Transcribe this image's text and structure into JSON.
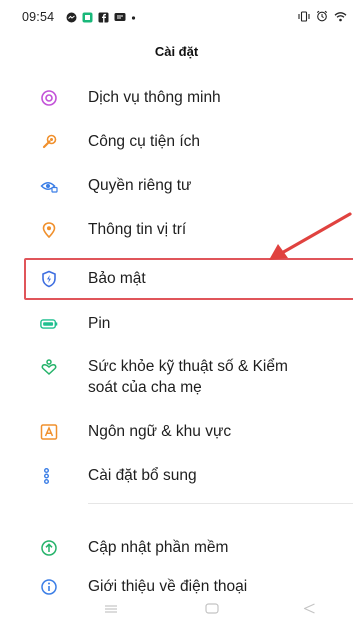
{
  "status_bar": {
    "time": "09:54"
  },
  "header": {
    "title": "Cài đặt"
  },
  "items": [
    {
      "label": "Dịch vụ thông minh",
      "icon": "smart-services-icon",
      "color": "#c251d8"
    },
    {
      "label": "Công cụ tiện ích",
      "icon": "utility-tools-icon",
      "color": "#f0902d"
    },
    {
      "label": "Quyền riêng tư",
      "icon": "privacy-icon",
      "color": "#3b7ee6"
    },
    {
      "label": "Thông tin vị trí",
      "icon": "location-icon",
      "color": "#f0902d"
    },
    {
      "label": "Bảo mật",
      "icon": "security-shield-icon",
      "color": "#3f6fe0"
    },
    {
      "label": "Pin",
      "icon": "battery-icon",
      "color": "#1fbf8f"
    },
    {
      "label": "Sức khỏe kỹ thuật số & Kiểm",
      "label_line2": "soát của cha mẹ",
      "icon": "digital-wellbeing-icon",
      "color": "#25b36a"
    },
    {
      "label": "Ngôn ngữ & khu vực",
      "icon": "language-icon",
      "color": "#f0902d"
    },
    {
      "label": "Cài đặt bổ sung",
      "icon": "additional-settings-icon",
      "color": "#3b7ee6"
    },
    {
      "label": "Cập nhật phần mềm",
      "icon": "software-update-icon",
      "color": "#25b36a"
    },
    {
      "label": "Giới thiệu về điện thoại",
      "icon": "about-phone-icon",
      "color": "#3b7ee6"
    }
  ],
  "annotation": {
    "highlight_color": "#e0555a",
    "arrow_color": "#e0423f"
  }
}
